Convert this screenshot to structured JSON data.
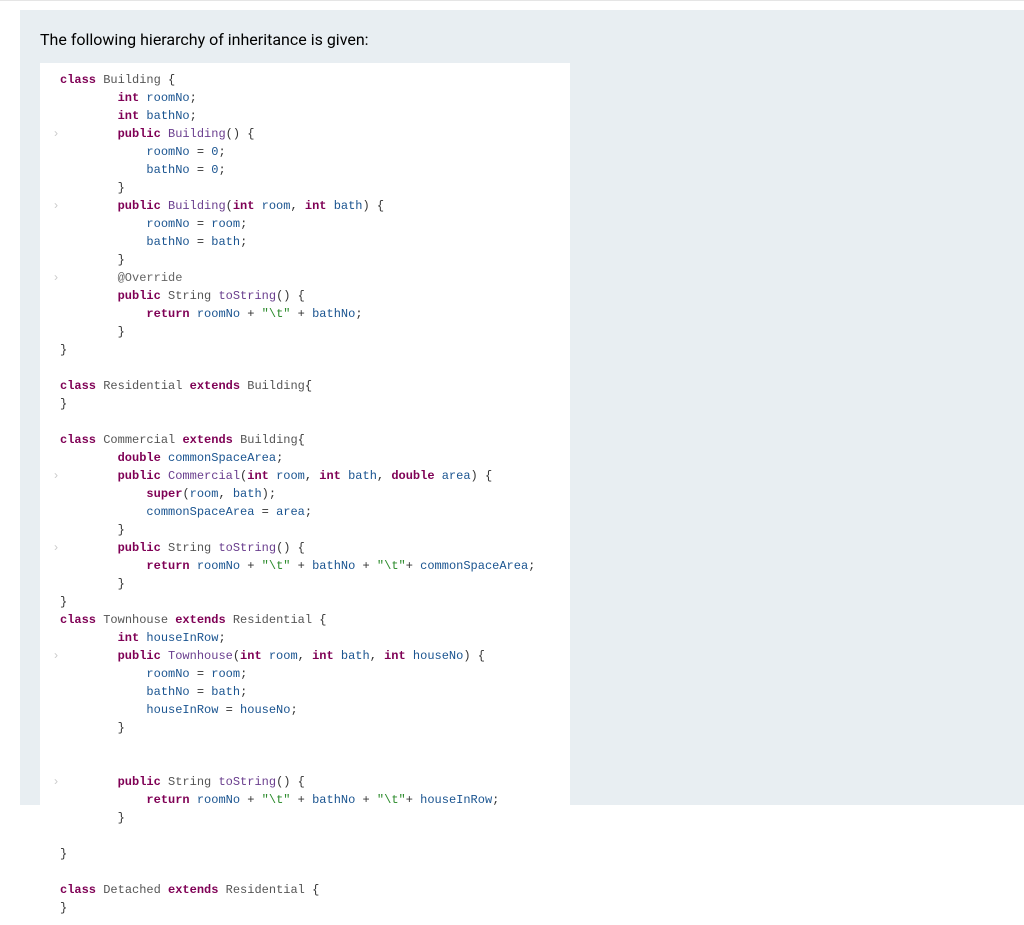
{
  "intro": "The following hierarchy of inheritance is given:",
  "code": {
    "lines": [
      {
        "indent": 0,
        "tokens": [
          {
            "t": "kw",
            "v": "class"
          },
          {
            "t": "p",
            "v": " "
          },
          {
            "t": "type",
            "v": "Building"
          },
          {
            "t": "p",
            "v": " {"
          }
        ]
      },
      {
        "indent": 2,
        "tokens": [
          {
            "t": "kw",
            "v": "int"
          },
          {
            "t": "p",
            "v": " "
          },
          {
            "t": "var",
            "v": "roomNo"
          },
          {
            "t": "p",
            "v": ";"
          }
        ]
      },
      {
        "indent": 2,
        "tokens": [
          {
            "t": "kw",
            "v": "int"
          },
          {
            "t": "p",
            "v": " "
          },
          {
            "t": "var",
            "v": "bathNo"
          },
          {
            "t": "p",
            "v": ";"
          }
        ]
      },
      {
        "indent": 2,
        "gutter": true,
        "tokens": [
          {
            "t": "kw",
            "v": "public"
          },
          {
            "t": "p",
            "v": " "
          },
          {
            "t": "ident",
            "v": "Building"
          },
          {
            "t": "p",
            "v": "() {"
          }
        ]
      },
      {
        "indent": 3,
        "tokens": [
          {
            "t": "var",
            "v": "roomNo"
          },
          {
            "t": "p",
            "v": " = "
          },
          {
            "t": "num",
            "v": "0"
          },
          {
            "t": "p",
            "v": ";"
          }
        ]
      },
      {
        "indent": 3,
        "tokens": [
          {
            "t": "var",
            "v": "bathNo"
          },
          {
            "t": "p",
            "v": " = "
          },
          {
            "t": "num",
            "v": "0"
          },
          {
            "t": "p",
            "v": ";"
          }
        ]
      },
      {
        "indent": 2,
        "tokens": [
          {
            "t": "p",
            "v": "}"
          }
        ]
      },
      {
        "indent": 2,
        "gutter": true,
        "tokens": [
          {
            "t": "kw",
            "v": "public"
          },
          {
            "t": "p",
            "v": " "
          },
          {
            "t": "ident",
            "v": "Building"
          },
          {
            "t": "p",
            "v": "("
          },
          {
            "t": "kw",
            "v": "int"
          },
          {
            "t": "p",
            "v": " "
          },
          {
            "t": "var",
            "v": "room"
          },
          {
            "t": "p",
            "v": ", "
          },
          {
            "t": "kw",
            "v": "int"
          },
          {
            "t": "p",
            "v": " "
          },
          {
            "t": "var",
            "v": "bath"
          },
          {
            "t": "p",
            "v": ") {"
          }
        ]
      },
      {
        "indent": 3,
        "tokens": [
          {
            "t": "var",
            "v": "roomNo"
          },
          {
            "t": "p",
            "v": " = "
          },
          {
            "t": "var",
            "v": "room"
          },
          {
            "t": "p",
            "v": ";"
          }
        ]
      },
      {
        "indent": 3,
        "tokens": [
          {
            "t": "var",
            "v": "bathNo"
          },
          {
            "t": "p",
            "v": " = "
          },
          {
            "t": "var",
            "v": "bath"
          },
          {
            "t": "p",
            "v": ";"
          }
        ]
      },
      {
        "indent": 2,
        "tokens": [
          {
            "t": "p",
            "v": "}"
          }
        ]
      },
      {
        "indent": 2,
        "gutter": true,
        "tokens": [
          {
            "t": "annot",
            "v": "@Override"
          }
        ]
      },
      {
        "indent": 2,
        "tokens": [
          {
            "t": "kw",
            "v": "public"
          },
          {
            "t": "p",
            "v": " "
          },
          {
            "t": "type",
            "v": "String"
          },
          {
            "t": "p",
            "v": " "
          },
          {
            "t": "ident",
            "v": "toString"
          },
          {
            "t": "p",
            "v": "() {"
          }
        ]
      },
      {
        "indent": 3,
        "tokens": [
          {
            "t": "kw",
            "v": "return"
          },
          {
            "t": "p",
            "v": " "
          },
          {
            "t": "var",
            "v": "roomNo"
          },
          {
            "t": "p",
            "v": " + "
          },
          {
            "t": "str",
            "v": "\"\\t\""
          },
          {
            "t": "p",
            "v": " + "
          },
          {
            "t": "var",
            "v": "bathNo"
          },
          {
            "t": "p",
            "v": ";"
          }
        ]
      },
      {
        "indent": 2,
        "tokens": [
          {
            "t": "p",
            "v": "}"
          }
        ]
      },
      {
        "indent": 0,
        "tokens": [
          {
            "t": "p",
            "v": "}"
          }
        ]
      },
      {
        "indent": 0,
        "tokens": []
      },
      {
        "indent": 0,
        "tokens": [
          {
            "t": "kw",
            "v": "class"
          },
          {
            "t": "p",
            "v": " "
          },
          {
            "t": "type",
            "v": "Residential"
          },
          {
            "t": "p",
            "v": " "
          },
          {
            "t": "kw",
            "v": "extends"
          },
          {
            "t": "p",
            "v": " "
          },
          {
            "t": "type",
            "v": "Building"
          },
          {
            "t": "p",
            "v": "{"
          }
        ]
      },
      {
        "indent": 0,
        "tokens": [
          {
            "t": "p",
            "v": "}"
          }
        ]
      },
      {
        "indent": 0,
        "tokens": []
      },
      {
        "indent": 0,
        "tokens": [
          {
            "t": "kw",
            "v": "class"
          },
          {
            "t": "p",
            "v": " "
          },
          {
            "t": "type",
            "v": "Commercial"
          },
          {
            "t": "p",
            "v": " "
          },
          {
            "t": "kw",
            "v": "extends"
          },
          {
            "t": "p",
            "v": " "
          },
          {
            "t": "type",
            "v": "Building"
          },
          {
            "t": "p",
            "v": "{"
          }
        ]
      },
      {
        "indent": 2,
        "tokens": [
          {
            "t": "kw",
            "v": "double"
          },
          {
            "t": "p",
            "v": " "
          },
          {
            "t": "var",
            "v": "commonSpaceArea"
          },
          {
            "t": "p",
            "v": ";"
          }
        ]
      },
      {
        "indent": 2,
        "gutter": true,
        "tokens": [
          {
            "t": "kw",
            "v": "public"
          },
          {
            "t": "p",
            "v": " "
          },
          {
            "t": "ident",
            "v": "Commercial"
          },
          {
            "t": "p",
            "v": "("
          },
          {
            "t": "kw",
            "v": "int"
          },
          {
            "t": "p",
            "v": " "
          },
          {
            "t": "var",
            "v": "room"
          },
          {
            "t": "p",
            "v": ", "
          },
          {
            "t": "kw",
            "v": "int"
          },
          {
            "t": "p",
            "v": " "
          },
          {
            "t": "var",
            "v": "bath"
          },
          {
            "t": "p",
            "v": ", "
          },
          {
            "t": "kw",
            "v": "double"
          },
          {
            "t": "p",
            "v": " "
          },
          {
            "t": "var",
            "v": "area"
          },
          {
            "t": "p",
            "v": ") {"
          }
        ]
      },
      {
        "indent": 3,
        "tokens": [
          {
            "t": "kw",
            "v": "super"
          },
          {
            "t": "p",
            "v": "("
          },
          {
            "t": "var",
            "v": "room"
          },
          {
            "t": "p",
            "v": ", "
          },
          {
            "t": "var",
            "v": "bath"
          },
          {
            "t": "p",
            "v": ");"
          }
        ]
      },
      {
        "indent": 3,
        "tokens": [
          {
            "t": "var",
            "v": "commonSpaceArea"
          },
          {
            "t": "p",
            "v": " = "
          },
          {
            "t": "var",
            "v": "area"
          },
          {
            "t": "p",
            "v": ";"
          }
        ]
      },
      {
        "indent": 2,
        "tokens": [
          {
            "t": "p",
            "v": "}"
          }
        ]
      },
      {
        "indent": 2,
        "gutter": true,
        "tokens": [
          {
            "t": "kw",
            "v": "public"
          },
          {
            "t": "p",
            "v": " "
          },
          {
            "t": "type",
            "v": "String"
          },
          {
            "t": "p",
            "v": " "
          },
          {
            "t": "ident",
            "v": "toString"
          },
          {
            "t": "p",
            "v": "() {"
          }
        ]
      },
      {
        "indent": 3,
        "tokens": [
          {
            "t": "kw",
            "v": "return"
          },
          {
            "t": "p",
            "v": " "
          },
          {
            "t": "var",
            "v": "roomNo"
          },
          {
            "t": "p",
            "v": " + "
          },
          {
            "t": "str",
            "v": "\"\\t\""
          },
          {
            "t": "p",
            "v": " + "
          },
          {
            "t": "var",
            "v": "bathNo"
          },
          {
            "t": "p",
            "v": " + "
          },
          {
            "t": "str",
            "v": "\"\\t\""
          },
          {
            "t": "p",
            "v": "+ "
          },
          {
            "t": "var",
            "v": "commonSpaceArea"
          },
          {
            "t": "p",
            "v": ";"
          }
        ]
      },
      {
        "indent": 2,
        "tokens": [
          {
            "t": "p",
            "v": "}"
          }
        ]
      },
      {
        "indent": 0,
        "tokens": [
          {
            "t": "p",
            "v": "}"
          }
        ]
      },
      {
        "indent": 0,
        "tokens": [
          {
            "t": "kw",
            "v": "class"
          },
          {
            "t": "p",
            "v": " "
          },
          {
            "t": "type",
            "v": "Townhouse"
          },
          {
            "t": "p",
            "v": " "
          },
          {
            "t": "kw",
            "v": "extends"
          },
          {
            "t": "p",
            "v": " "
          },
          {
            "t": "type",
            "v": "Residential"
          },
          {
            "t": "p",
            "v": " {"
          }
        ]
      },
      {
        "indent": 2,
        "tokens": [
          {
            "t": "kw",
            "v": "int"
          },
          {
            "t": "p",
            "v": " "
          },
          {
            "t": "var",
            "v": "houseInRow"
          },
          {
            "t": "p",
            "v": ";"
          }
        ]
      },
      {
        "indent": 2,
        "gutter": true,
        "tokens": [
          {
            "t": "kw",
            "v": "public"
          },
          {
            "t": "p",
            "v": " "
          },
          {
            "t": "ident",
            "v": "Townhouse"
          },
          {
            "t": "p",
            "v": "("
          },
          {
            "t": "kw",
            "v": "int"
          },
          {
            "t": "p",
            "v": " "
          },
          {
            "t": "var",
            "v": "room"
          },
          {
            "t": "p",
            "v": ", "
          },
          {
            "t": "kw",
            "v": "int"
          },
          {
            "t": "p",
            "v": " "
          },
          {
            "t": "var",
            "v": "bath"
          },
          {
            "t": "p",
            "v": ", "
          },
          {
            "t": "kw",
            "v": "int"
          },
          {
            "t": "p",
            "v": " "
          },
          {
            "t": "var",
            "v": "houseNo"
          },
          {
            "t": "p",
            "v": ") {"
          }
        ]
      },
      {
        "indent": 3,
        "tokens": [
          {
            "t": "var",
            "v": "roomNo"
          },
          {
            "t": "p",
            "v": " = "
          },
          {
            "t": "var",
            "v": "room"
          },
          {
            "t": "p",
            "v": ";"
          }
        ]
      },
      {
        "indent": 3,
        "tokens": [
          {
            "t": "var",
            "v": "bathNo"
          },
          {
            "t": "p",
            "v": " = "
          },
          {
            "t": "var",
            "v": "bath"
          },
          {
            "t": "p",
            "v": ";"
          }
        ]
      },
      {
        "indent": 3,
        "tokens": [
          {
            "t": "var",
            "v": "houseInRow"
          },
          {
            "t": "p",
            "v": " = "
          },
          {
            "t": "var",
            "v": "houseNo"
          },
          {
            "t": "p",
            "v": ";"
          }
        ]
      },
      {
        "indent": 2,
        "tokens": [
          {
            "t": "p",
            "v": "}"
          }
        ]
      },
      {
        "indent": 0,
        "tokens": []
      },
      {
        "indent": 0,
        "tokens": []
      },
      {
        "indent": 2,
        "gutter": true,
        "tokens": [
          {
            "t": "kw",
            "v": "public"
          },
          {
            "t": "p",
            "v": " "
          },
          {
            "t": "type",
            "v": "String"
          },
          {
            "t": "p",
            "v": " "
          },
          {
            "t": "ident",
            "v": "toString"
          },
          {
            "t": "p",
            "v": "() {"
          }
        ]
      },
      {
        "indent": 3,
        "tokens": [
          {
            "t": "kw",
            "v": "return"
          },
          {
            "t": "p",
            "v": " "
          },
          {
            "t": "var",
            "v": "roomNo"
          },
          {
            "t": "p",
            "v": " + "
          },
          {
            "t": "str",
            "v": "\"\\t\""
          },
          {
            "t": "p",
            "v": " + "
          },
          {
            "t": "var",
            "v": "bathNo"
          },
          {
            "t": "p",
            "v": " + "
          },
          {
            "t": "str",
            "v": "\"\\t\""
          },
          {
            "t": "p",
            "v": "+ "
          },
          {
            "t": "var",
            "v": "houseInRow"
          },
          {
            "t": "p",
            "v": ";"
          }
        ]
      },
      {
        "indent": 2,
        "tokens": [
          {
            "t": "p",
            "v": "}"
          }
        ]
      },
      {
        "indent": 0,
        "tokens": []
      },
      {
        "indent": 0,
        "tokens": [
          {
            "t": "p",
            "v": "}"
          }
        ]
      },
      {
        "indent": 0,
        "tokens": []
      },
      {
        "indent": 0,
        "tokens": [
          {
            "t": "kw",
            "v": "class"
          },
          {
            "t": "p",
            "v": " "
          },
          {
            "t": "type",
            "v": "Detached"
          },
          {
            "t": "p",
            "v": " "
          },
          {
            "t": "kw",
            "v": "extends"
          },
          {
            "t": "p",
            "v": " "
          },
          {
            "t": "type",
            "v": "Residential"
          },
          {
            "t": "p",
            "v": " {"
          }
        ]
      },
      {
        "indent": 0,
        "tokens": [
          {
            "t": "p",
            "v": "}"
          }
        ]
      }
    ]
  }
}
